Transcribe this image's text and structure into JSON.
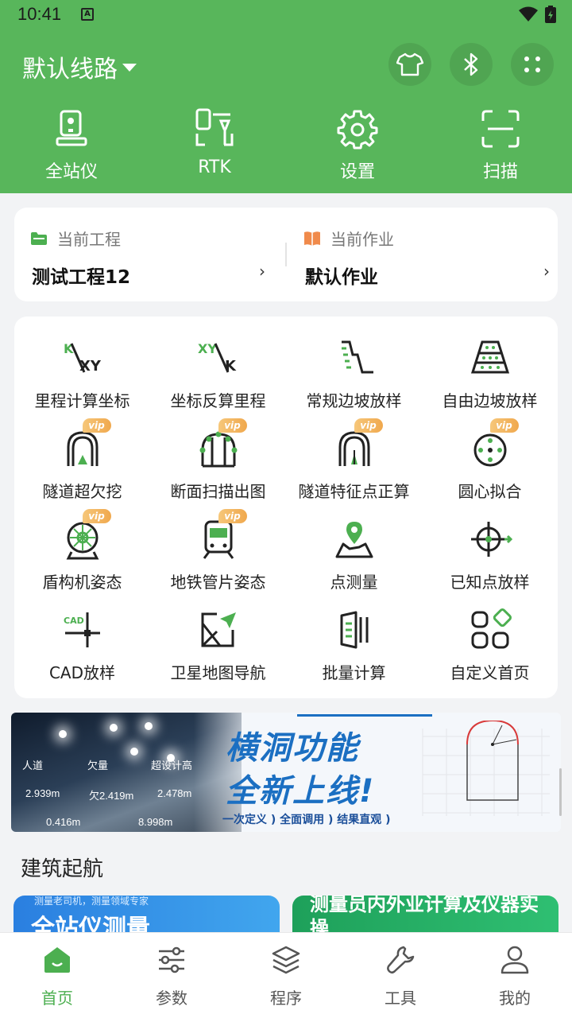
{
  "status_bar": {
    "time": "10:41",
    "ime_badge": "A"
  },
  "header": {
    "route_title": "默认线路",
    "buttons": [
      "shirt-icon",
      "bluetooth-icon",
      "more-icon"
    ],
    "tools": [
      {
        "label": "全站仪",
        "icon": "total-station-icon"
      },
      {
        "label": "RTK",
        "icon": "rtk-icon"
      },
      {
        "label": "设置",
        "icon": "gear-icon"
      },
      {
        "label": "扫描",
        "icon": "scan-icon"
      }
    ]
  },
  "project": {
    "current_project_label": "当前工程",
    "current_project_value": "测试工程12",
    "current_job_label": "当前作业",
    "current_job_value": "默认作业",
    "chevron": "›"
  },
  "functions": [
    {
      "label": "里程计算坐标",
      "icon": "k-to-xy-icon",
      "vip": false
    },
    {
      "label": "坐标反算里程",
      "icon": "xy-to-k-icon",
      "vip": false
    },
    {
      "label": "常规边坡放样",
      "icon": "slope-icon",
      "vip": false
    },
    {
      "label": "自由边坡放样",
      "icon": "free-slope-icon",
      "vip": false
    },
    {
      "label": "隧道超欠挖",
      "icon": "tunnel-icon",
      "vip": true
    },
    {
      "label": "断面扫描出图",
      "icon": "section-scan-icon",
      "vip": true
    },
    {
      "label": "隧道特征点正算",
      "icon": "tunnel-feature-icon",
      "vip": true
    },
    {
      "label": "圆心拟合",
      "icon": "circle-fit-icon",
      "vip": true
    },
    {
      "label": "盾构机姿态",
      "icon": "shield-machine-icon",
      "vip": true
    },
    {
      "label": "地铁管片姿态",
      "icon": "metro-icon",
      "vip": true
    },
    {
      "label": "点测量",
      "icon": "map-pin-icon",
      "vip": false
    },
    {
      "label": "已知点放样",
      "icon": "crosshair-icon",
      "vip": false
    },
    {
      "label": "CAD放样",
      "icon": "cad-icon",
      "vip": false
    },
    {
      "label": "卫星地图导航",
      "icon": "satellite-nav-icon",
      "vip": false
    },
    {
      "label": "批量计算",
      "icon": "batch-icon",
      "vip": false
    },
    {
      "label": "自定义首页",
      "icon": "custom-home-icon",
      "vip": false
    }
  ],
  "vip_label": "vip",
  "banner": {
    "title_line1": "横洞功能",
    "title_line2": "全新上线!",
    "subtitle": "一次定义 ) 全面调用 ) 结果直观 )",
    "photo_values": [
      "2.939m",
      "欠2.419m",
      "2.478m",
      "0.416m",
      "8.998m"
    ],
    "photo_labels": [
      "人道",
      "欠量",
      "超设计高"
    ]
  },
  "section_title": "建筑起航",
  "promos": [
    {
      "tag": "测量老司机，测量领域专家",
      "title": "全站仪测量"
    },
    {
      "tag": "",
      "title": "测量员内外业计算及仪器实操"
    }
  ],
  "nav": [
    {
      "label": "首页",
      "icon": "home-icon",
      "active": true
    },
    {
      "label": "参数",
      "icon": "sliders-icon",
      "active": false
    },
    {
      "label": "程序",
      "icon": "layers-icon",
      "active": false
    },
    {
      "label": "工具",
      "icon": "wrench-icon",
      "active": false
    },
    {
      "label": "我的",
      "icon": "user-icon",
      "active": false
    }
  ],
  "colors": {
    "primary": "#58b65b",
    "accent_green": "#4caf50",
    "vip_orange": "#f0a84d",
    "banner_blue": "#1b6fc2"
  }
}
